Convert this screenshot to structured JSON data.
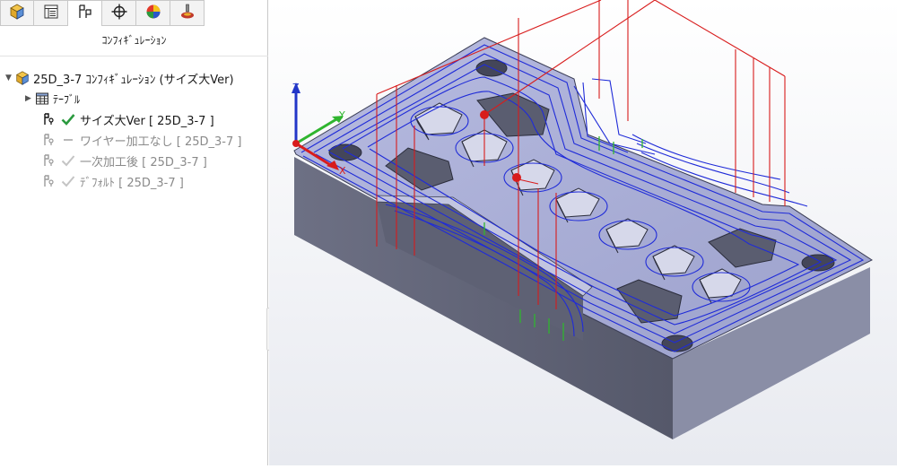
{
  "panel": {
    "tabs": [
      {
        "icon": "part-icon"
      },
      {
        "icon": "property-list-icon"
      },
      {
        "icon": "configuration-manager-icon",
        "active": true
      },
      {
        "icon": "crosshair-icon"
      },
      {
        "icon": "appearance-icon"
      },
      {
        "icon": "cam-icon"
      }
    ],
    "title": "ｺﾝﾌｨｷﾞｭﾚｰｼｮﾝ",
    "tree": {
      "root_label": "25D_3-7 ｺﾝﾌｨｷﾞｭﾚｰｼｮﾝ  (サイズ大Ver)",
      "table_label": "ﾃｰﾌﾞﾙ",
      "configs": [
        {
          "label": "サイズ大Ver [ 25D_3-7 ]",
          "active": true
        },
        {
          "label": "ワイヤー加工なし [ 25D_3-7 ]",
          "active": false
        },
        {
          "label": "一次加工後 [ 25D_3-7 ]",
          "active": false
        },
        {
          "label": "ﾃﾞﾌｫﾙﾄ [ 25D_3-7 ]",
          "active": false
        }
      ]
    }
  },
  "viewport": {
    "triad": {
      "x": "X",
      "y": "Y",
      "z": "Z"
    },
    "colors": {
      "toolpath": "#1f2bd8",
      "rapid": "#d81c1c",
      "plunge": "#2fb52f",
      "part_top": "#a7abd2",
      "part_side": "#5c5f72",
      "part_front": "#8a8ea6"
    }
  }
}
